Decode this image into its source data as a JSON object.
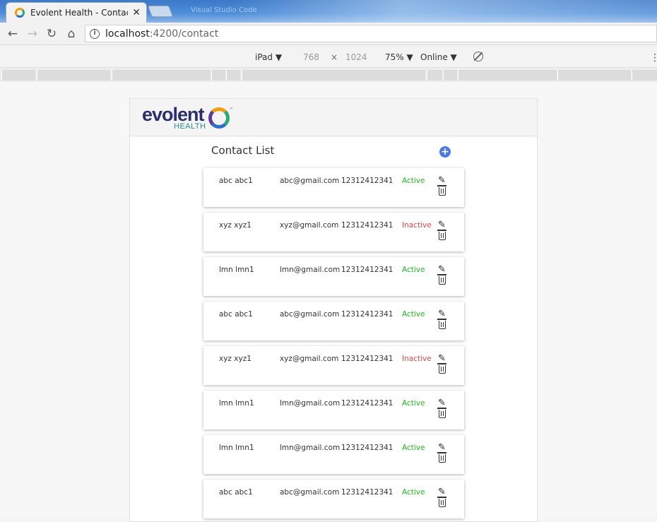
{
  "browser": {
    "tab_title": "Evolent Health - Contact",
    "tab_close": "✕",
    "ghost_tab_text": "Visual Studio Code",
    "url_host": "localhost",
    "url_path": ":4200/contact"
  },
  "devtools": {
    "device": "iPad ▼",
    "width": "768",
    "times": "×",
    "height": "1024",
    "zoom": "75% ▼",
    "network": "Online ▼"
  },
  "header": {
    "logo_text": "evolent",
    "logo_sub": "HEALTH",
    "logo_tm": "™"
  },
  "contacts": {
    "title": "Contact List",
    "add_symbol": "+",
    "items": [
      {
        "name": "abc abc1",
        "email": "abc@gmail.com",
        "phone": "12312412341",
        "status": "Active"
      },
      {
        "name": "xyz xyz1",
        "email": "xyz@gmail.com",
        "phone": "12312412341",
        "status": "Inactive"
      },
      {
        "name": "lmn lmn1",
        "email": "lmn@gmail.com",
        "phone": "12312412341",
        "status": "Active"
      },
      {
        "name": "abc abc1",
        "email": "abc@gmail.com",
        "phone": "12312412341",
        "status": "Active"
      },
      {
        "name": "xyz xyz1",
        "email": "xyz@gmail.com",
        "phone": "12312412341",
        "status": "Inactive"
      },
      {
        "name": "lmn lmn1",
        "email": "lmn@gmail.com",
        "phone": "12312412341",
        "status": "Active"
      },
      {
        "name": "lmn lmn1",
        "email": "lmn@gmail.com",
        "phone": "12312412341",
        "status": "Active"
      },
      {
        "name": "abc abc1",
        "email": "abc@gmail.com",
        "phone": "12312412341",
        "status": "Active"
      }
    ]
  },
  "colors": {
    "active": "#22b722",
    "inactive": "#e04848",
    "accent": "#4a7be0",
    "brand_navy": "#2b2f6b"
  }
}
